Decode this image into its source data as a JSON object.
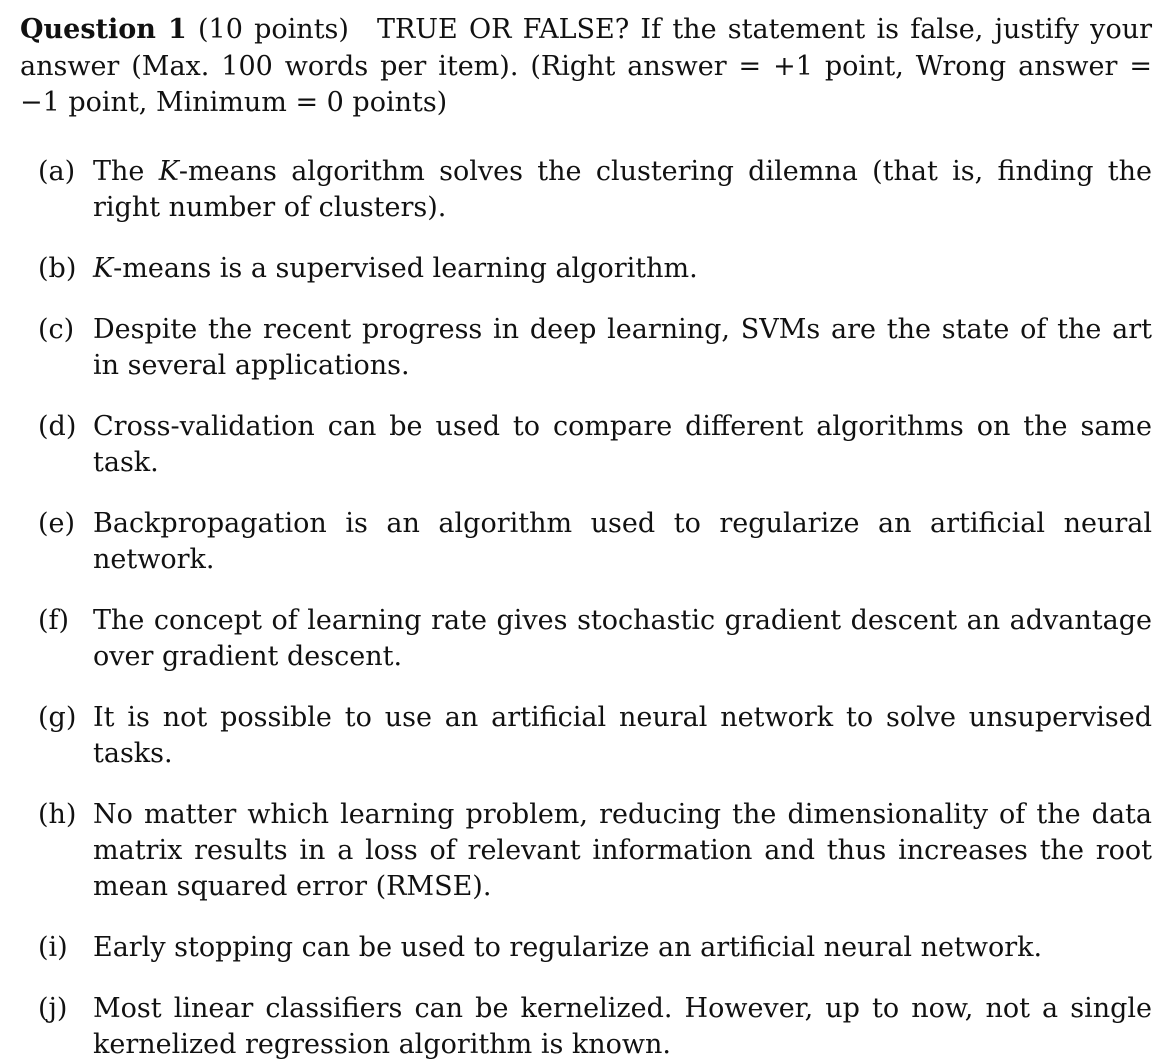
{
  "question": {
    "label": "Question 1",
    "points": "(10 points)",
    "instruction": "TRUE OR FALSE? If the statement is false, justify your answer (Max.  100 words per item).  (Right answer = +1 point, Wrong answer = −1 point, Minimum = 0  points)"
  },
  "items": [
    {
      "marker": "(a)",
      "text_pre": "The ",
      "text_var": "K",
      "text_post": "-means algorithm solves the clustering dilemna (that is, finding the right number of clusters)."
    },
    {
      "marker": "(b)",
      "text_pre": "",
      "text_var": "K",
      "text_post": "-means is a supervised learning algorithm."
    },
    {
      "marker": "(c)",
      "text_pre": "Despite the recent progress in deep learning, SVMs are the state of the art in several applications.",
      "text_var": "",
      "text_post": ""
    },
    {
      "marker": "(d)",
      "text_pre": "Cross-validation can be used to compare different algorithms on the same task.",
      "text_var": "",
      "text_post": ""
    },
    {
      "marker": "(e)",
      "text_pre": "Backpropagation is an algorithm used to regularize an artificial neural network.",
      "text_var": "",
      "text_post": ""
    },
    {
      "marker": "(f)",
      "text_pre": "The concept of learning rate gives stochastic gradient descent an advantage over gradient descent.",
      "text_var": "",
      "text_post": ""
    },
    {
      "marker": "(g)",
      "text_pre": "It is not possible to use an artificial neural network to solve unsupervised tasks.",
      "text_var": "",
      "text_post": ""
    },
    {
      "marker": "(h)",
      "text_pre": "No matter which learning problem, reducing the dimensionality of the data matrix results in a loss of relevant information and thus increases the root mean squared error (RMSE).",
      "text_var": "",
      "text_post": ""
    },
    {
      "marker": "(i)",
      "text_pre": "Early stopping can be used to regularize an artificial neural network.",
      "text_var": "",
      "text_post": ""
    },
    {
      "marker": "(j)",
      "text_pre": "Most linear classifiers can be kernelized.  However, up to now, not a single kernelized regression algorithm is known.",
      "text_var": "",
      "text_post": ""
    }
  ]
}
